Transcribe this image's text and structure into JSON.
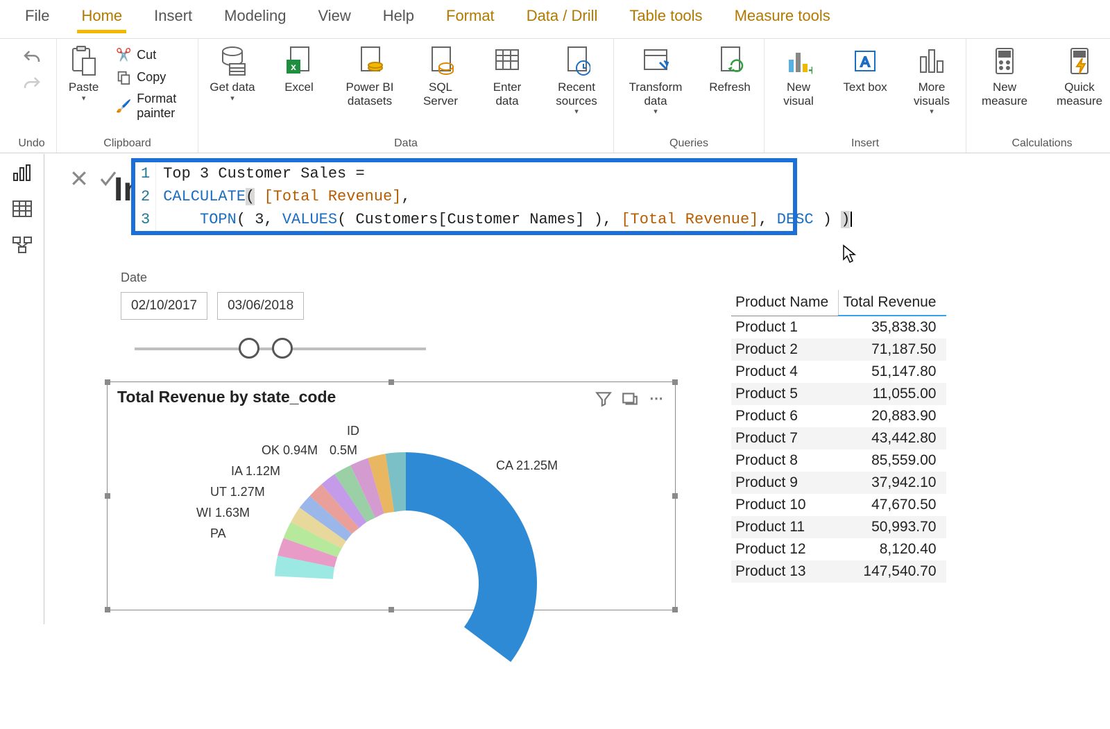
{
  "menu": {
    "file": "File",
    "home": "Home",
    "insert": "Insert",
    "modeling": "Modeling",
    "view": "View",
    "help": "Help",
    "format": "Format",
    "datadrill": "Data / Drill",
    "tabletools": "Table tools",
    "measuretools": "Measure tools"
  },
  "ribbon": {
    "undo": "Undo",
    "clipboard": {
      "label": "Clipboard",
      "paste": "Paste",
      "cut": "Cut",
      "copy": "Copy",
      "painter": "Format painter"
    },
    "data": {
      "label": "Data",
      "get": "Get data",
      "excel": "Excel",
      "pbi": "Power BI datasets",
      "sql": "SQL Server",
      "enter": "Enter data",
      "recent": "Recent sources"
    },
    "queries": {
      "label": "Queries",
      "transform": "Transform data",
      "refresh": "Refresh"
    },
    "insert": {
      "label": "Insert",
      "newvisual": "New visual",
      "textbox": "Text box",
      "more": "More visuals"
    },
    "calc": {
      "label": "Calculations",
      "newmeasure": "New measure",
      "quick": "Quick measure"
    }
  },
  "formula": {
    "l1_plain": "Top 3 Customer Sales = ",
    "l2_fn": "CALCULATE",
    "l2_paren": "(",
    "l2_rest1": " ",
    "l2_meas": "[Total Revenue]",
    "l2_rest2": ",",
    "l3_indent": "    ",
    "l3_fn": "TOPN",
    "l3_open": "( 3, ",
    "l3_values": "VALUES",
    "l3_mid": "( Customers[Customer Names] ), ",
    "l3_meas": "[Total Revenue]",
    "l3_c": ", ",
    "l3_desc": "DESC",
    "l3_close": " ) ",
    "l3_last": ")"
  },
  "hidden_title": "In",
  "date": {
    "label": "Date",
    "from": "02/10/2017",
    "to": "03/06/2018"
  },
  "chart": {
    "title": "Total Revenue by state_code"
  },
  "chart_data": {
    "type": "pie",
    "title": "Total Revenue by state_code",
    "unit": "M",
    "slices": [
      {
        "label": "CA",
        "value": 21.25
      },
      {
        "label": "PA",
        "value": 1.75
      },
      {
        "label": "WI",
        "value": 1.63
      },
      {
        "label": "UT",
        "value": 1.27
      },
      {
        "label": "IA",
        "value": 1.12
      },
      {
        "label": "OK",
        "value": 0.94
      },
      {
        "label": "ID",
        "value": 0.5
      }
    ],
    "visible_labels": [
      "CA 21.25M",
      "ID",
      "OK 0.94M",
      "0.5M",
      "IA 1.12M",
      "UT 1.27M",
      "WI 1.63M",
      "PA"
    ]
  },
  "products": {
    "headers": [
      "Product Name",
      "Total Revenue"
    ],
    "rows": [
      [
        "Product 1",
        "35,838.30"
      ],
      [
        "Product 2",
        "71,187.50"
      ],
      [
        "Product 4",
        "51,147.80"
      ],
      [
        "Product 5",
        "11,055.00"
      ],
      [
        "Product 6",
        "20,883.90"
      ],
      [
        "Product 7",
        "43,442.80"
      ],
      [
        "Product 8",
        "85,559.00"
      ],
      [
        "Product 9",
        "37,942.10"
      ],
      [
        "Product 10",
        "47,670.50"
      ],
      [
        "Product 11",
        "50,993.70"
      ],
      [
        "Product 12",
        "8,120.40"
      ],
      [
        "Product 13",
        "147,540.70"
      ]
    ]
  }
}
